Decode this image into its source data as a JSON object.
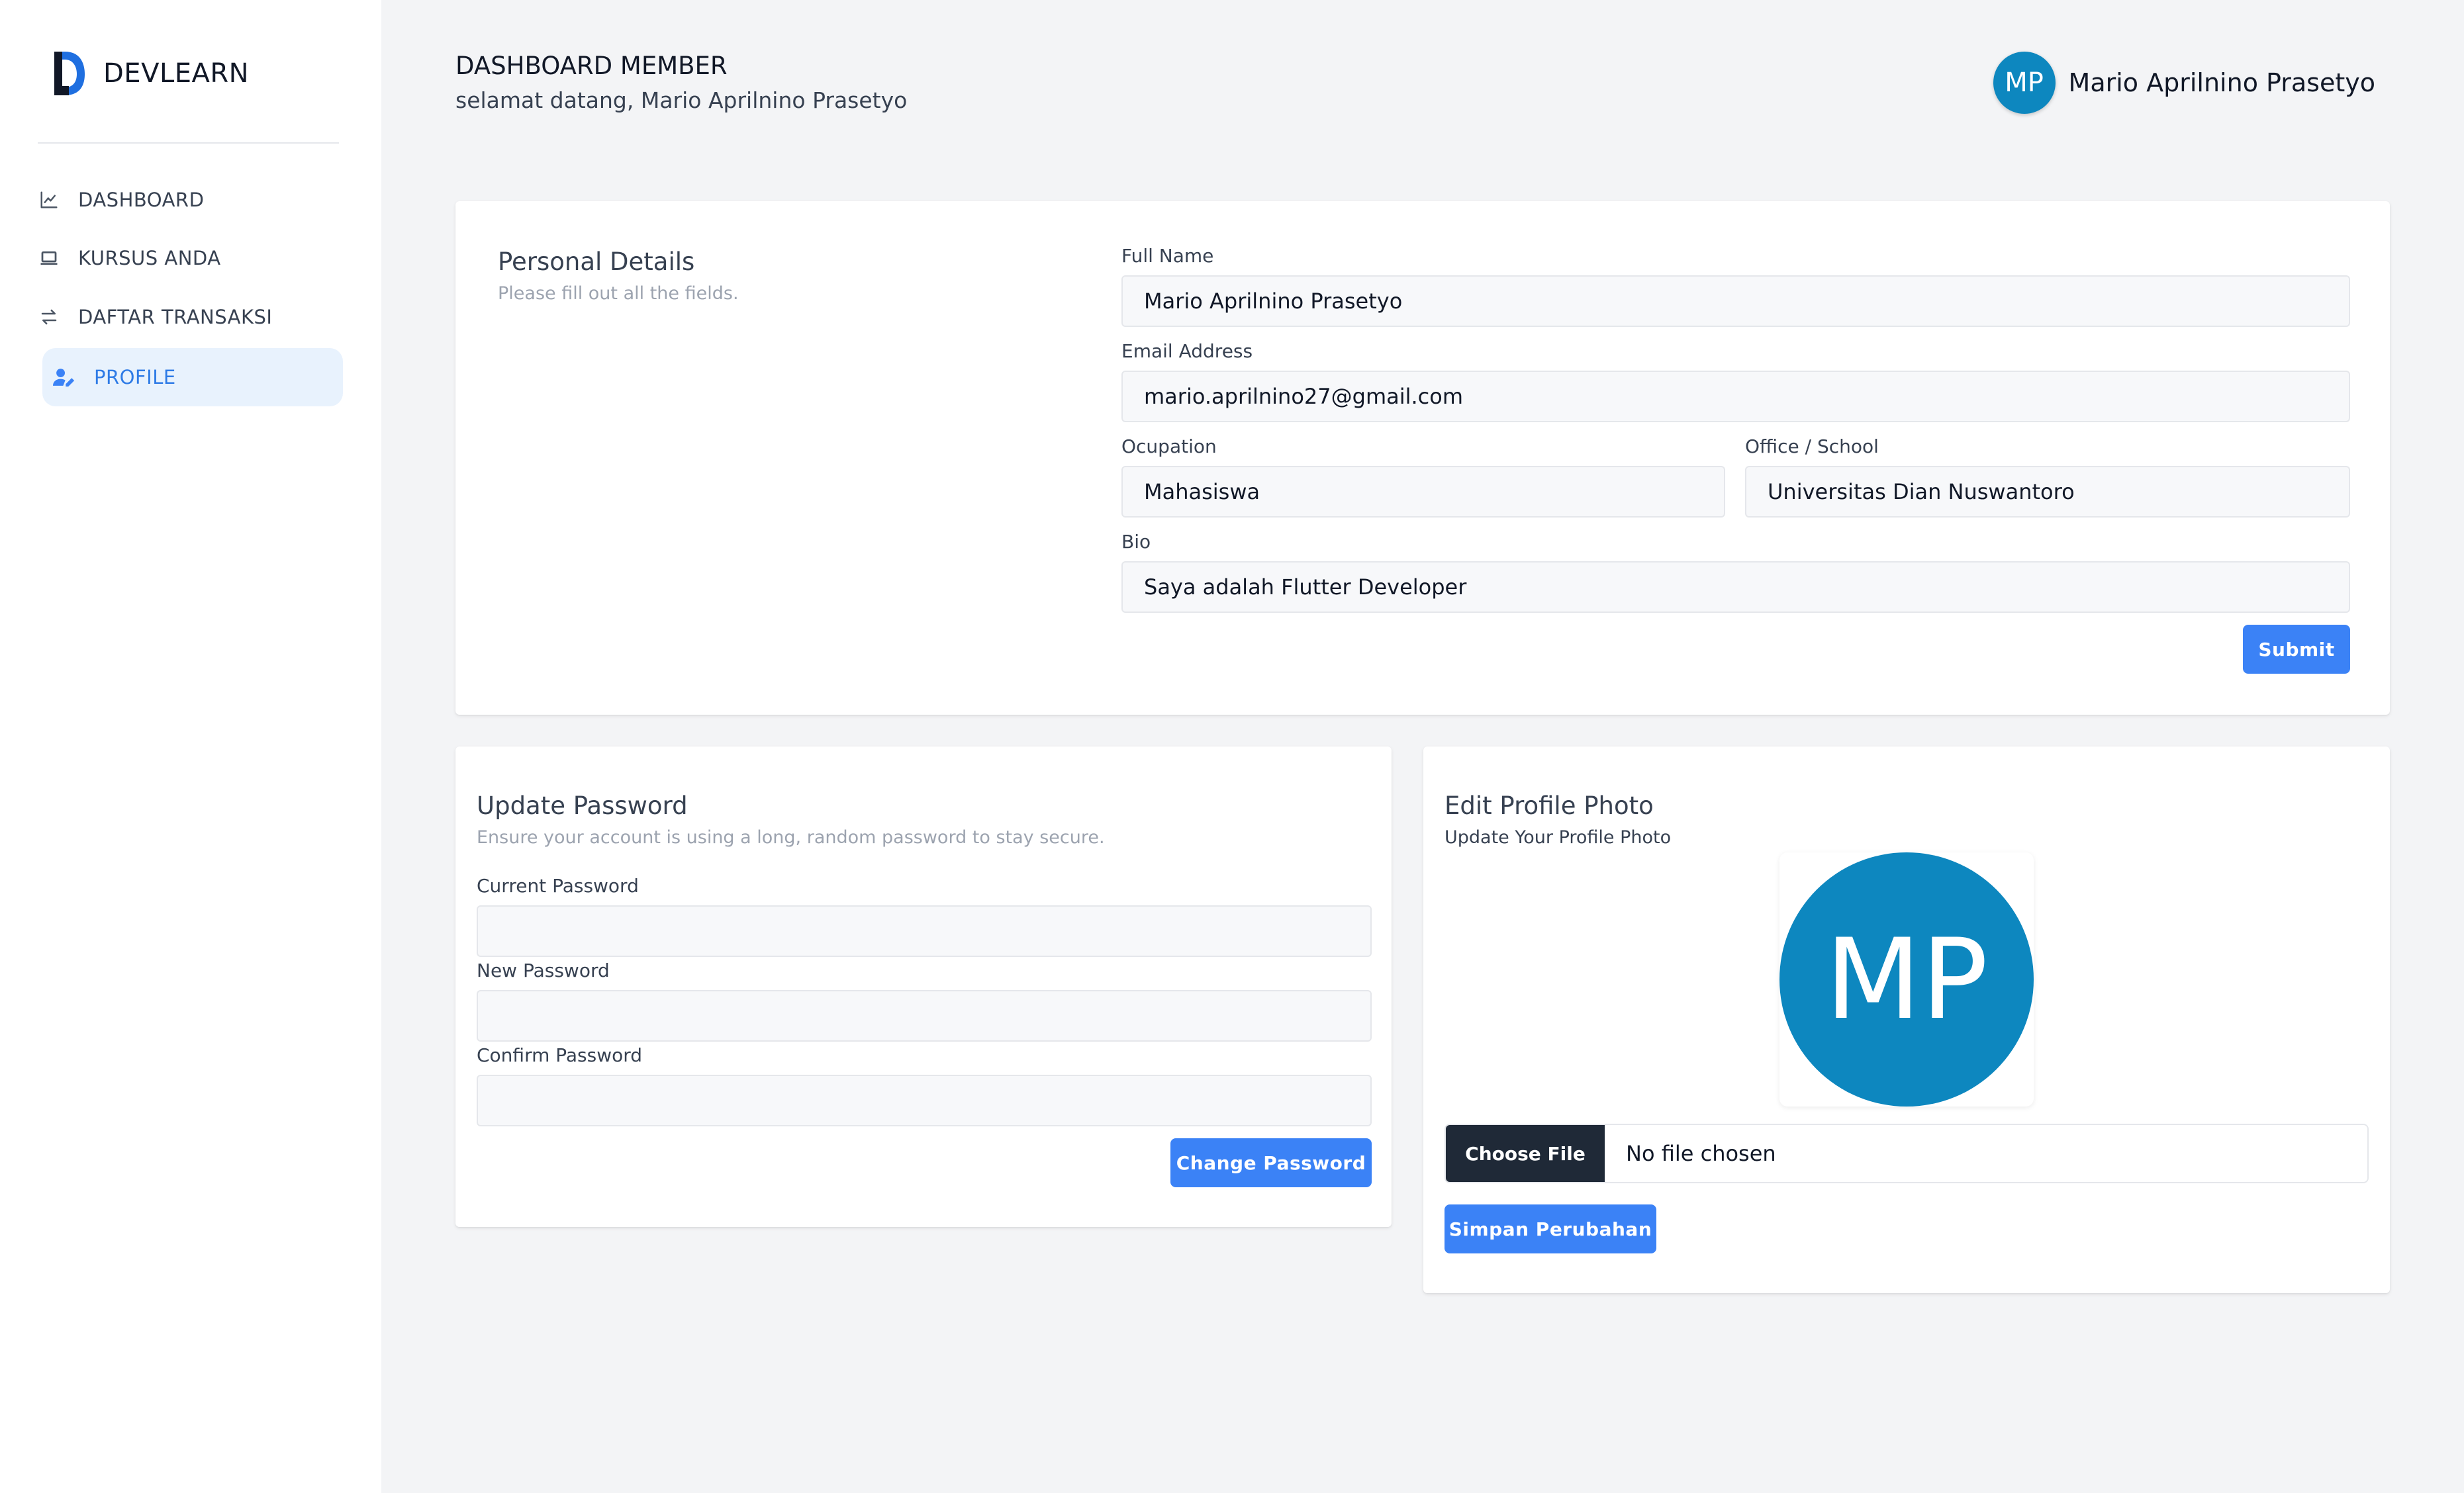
{
  "brand": {
    "name": "DEVLEARN",
    "logo_color": "#1f6fe0"
  },
  "sidebar": {
    "items": [
      {
        "label": "DASHBOARD",
        "icon": "chart-line-icon",
        "active": false
      },
      {
        "label": "KURSUS ANDA",
        "icon": "laptop-icon",
        "active": false
      },
      {
        "label": "DAFTAR TRANSAKSI",
        "icon": "arrows-exchange-icon",
        "active": false
      },
      {
        "label": "PROFILE",
        "icon": "user-edit-icon",
        "active": true
      }
    ]
  },
  "header": {
    "title": "DASHBOARD MEMBER",
    "subtitle": "selamat datang, Mario Aprilnino Prasetyo",
    "user": {
      "initials": "MP",
      "name": "Mario Aprilnino Prasetyo"
    }
  },
  "personal_details": {
    "title": "Personal Details",
    "description": "Please fill out all the fields.",
    "full_name_label": "Full Name",
    "full_name_value": "Mario Aprilnino Prasetyo",
    "email_label": "Email Address",
    "email_value": "mario.aprilnino27@gmail.com",
    "occupation_label": "Ocupation",
    "occupation_value": "Mahasiswa",
    "office_label": "Office / School",
    "office_value": "Universitas Dian Nuswantoro",
    "bio_label": "Bio",
    "bio_value": "Saya adalah Flutter Developer",
    "submit_label": "Submit"
  },
  "update_password": {
    "title": "Update Password",
    "description": "Ensure your account is using a long, random password to stay secure.",
    "current_label": "Current Password",
    "new_label": "New Password",
    "confirm_label": "Confirm Password",
    "button_label": "Change Password"
  },
  "profile_photo": {
    "title": "Edit Profile Photo",
    "description": "Update Your Profile Photo",
    "initials": "MP",
    "choose_file_label": "Choose File",
    "file_status": "No file chosen",
    "save_label": "Simpan Perubahan"
  },
  "colors": {
    "accent": "#3b82f6",
    "avatar": "#0d87bf",
    "active_nav_bg": "#e8f2fd",
    "active_nav_text": "#2e7be6"
  }
}
